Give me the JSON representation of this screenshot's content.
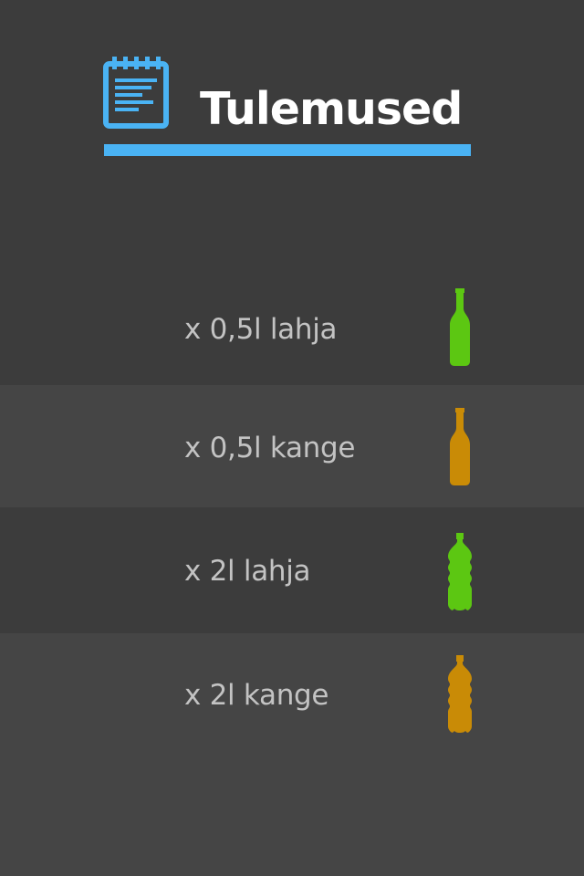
{
  "header": {
    "title": "Tulemused",
    "icon": "notepad-icon",
    "accent_color": "#4ab3f4"
  },
  "results": [
    {
      "label": "x 0,5l lahja",
      "icon": "bottle-small-icon",
      "color": "#5cc712"
    },
    {
      "label": "x 0,5l kange",
      "icon": "bottle-small-icon",
      "color": "#c98b06"
    },
    {
      "label": "x 2l lahja",
      "icon": "bottle-large-icon",
      "color": "#5cc712"
    },
    {
      "label": "x 2l kange",
      "icon": "bottle-large-icon",
      "color": "#c98b06"
    }
  ],
  "colors": {
    "background": "#3c3c3c",
    "row_alt": "#454545",
    "text": "#c3c3c3",
    "title": "#ffffff",
    "lahja": "#5cc712",
    "kange": "#c98b06"
  }
}
